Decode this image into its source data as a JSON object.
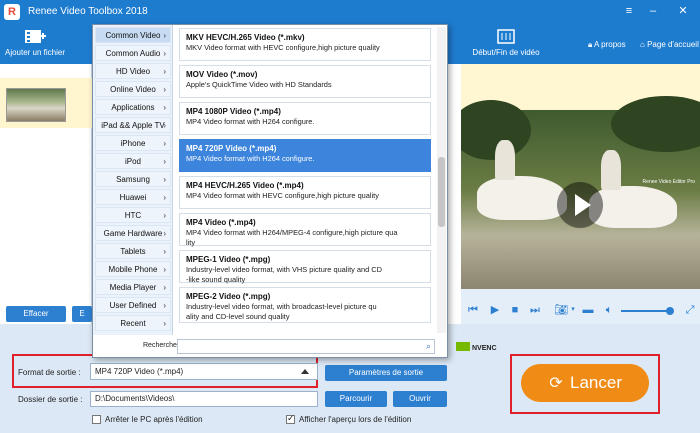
{
  "app": {
    "title": "Renee Video Toolbox 2018"
  },
  "toolbar": {
    "add_file": "Ajouter un fichier",
    "start_end": "Début/Fin de vidéo",
    "about": "A propos",
    "home": "Page d'accueil"
  },
  "left_panel": {
    "clear_label": "Effacer",
    "edit_label": "E"
  },
  "preview": {
    "watermark": "Renee Video Editor Pro"
  },
  "dropdown": {
    "categories": [
      "Common Video",
      "Common Audio",
      "HD Video",
      "Online Video",
      "Applications",
      "iPad && Apple TV",
      "iPhone",
      "iPod",
      "Samsung",
      "Huawei",
      "HTC",
      "Game Hardware",
      "Tablets",
      "Mobile Phone",
      "Media Player",
      "User Defined",
      "Recent"
    ],
    "active_category": "Common Video",
    "formats": [
      {
        "title": "MKV HEVC/H.265 Video (*.mkv)",
        "desc": [
          "MKV Video format with HEVC configure,high picture quality"
        ]
      },
      {
        "title": "MOV Video (*.mov)",
        "desc": [
          "Apple's QuickTime Video with HD Standards"
        ]
      },
      {
        "title": "MP4 1080P Video (*.mp4)",
        "desc": [
          "MP4 Video format with H264 configure."
        ]
      },
      {
        "title": "MP4 720P Video (*.mp4)",
        "desc": [
          "MP4 Video format with H264 configure."
        ]
      },
      {
        "title": "MP4 HEVC/H.265 Video (*.mp4)",
        "desc": [
          "MP4 Video format with HEVC configure,high picture quality"
        ]
      },
      {
        "title": "MP4 Video (*.mp4)",
        "desc": [
          "MP4 Video format with H264/MPEG-4 configure,high picture qua",
          "lity"
        ]
      },
      {
        "title": "MPEG-1 Video (*.mpg)",
        "desc": [
          "Industry-level video format, with VHS picture quality and CD",
          "-like sound quality"
        ]
      },
      {
        "title": "MPEG-2 Video (*.mpg)",
        "desc": [
          "Industry-level video format, with broadcast-level picture qu",
          "ality and CD-level sound quality"
        ]
      }
    ],
    "selected_format": "MP4 720P Video (*.mp4)",
    "search_label": "Recherche",
    "search_value": ""
  },
  "bottom": {
    "nvenc": "NVENC",
    "output_format_label": "Format de sortie :",
    "output_format_value": "MP4 720P Video (*.mp4)",
    "output_settings": "Paramètres de sortie",
    "output_folder_label": "Dossier de sortie :",
    "output_folder_value": "D:\\Documents\\Videos\\",
    "browse": "Parcourir",
    "open": "Ouvrir",
    "shutdown_label": "Arrêter le PC après l'édition",
    "shutdown_checked": false,
    "preview_label": "Afficher l'aperçu lors de l'édition",
    "preview_checked": true,
    "start": "Lancer"
  },
  "colors": {
    "accent": "#1e7ccf",
    "highlight": "#3d84dc",
    "start_button": "#f08c16",
    "annotation": "#e0202a"
  }
}
